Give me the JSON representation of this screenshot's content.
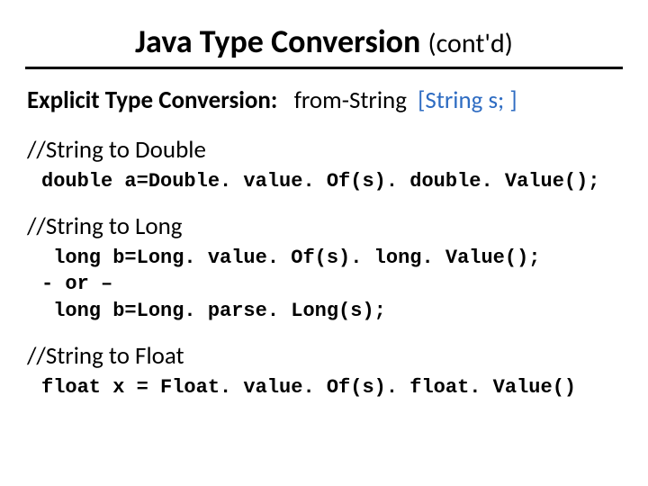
{
  "title": {
    "main": "Java Type Conversion",
    "contd": "(cont'd)"
  },
  "subtitle": {
    "label": "Explicit Type Conversion:",
    "plain": "from-String",
    "blue": "[String s; ]"
  },
  "sections": {
    "toDouble": {
      "heading": "//String to Double",
      "code": "double a=Double. value. Of(s). double. Value();"
    },
    "toLong": {
      "heading": "//String to Long",
      "code1": " long b=Long. value. Of(s). long. Value();",
      "or": "- or –",
      "code2": " long b=Long. parse. Long(s);"
    },
    "toFloat": {
      "heading": "//String to Float",
      "code": "float x = Float. value. Of(s). float. Value()"
    }
  }
}
